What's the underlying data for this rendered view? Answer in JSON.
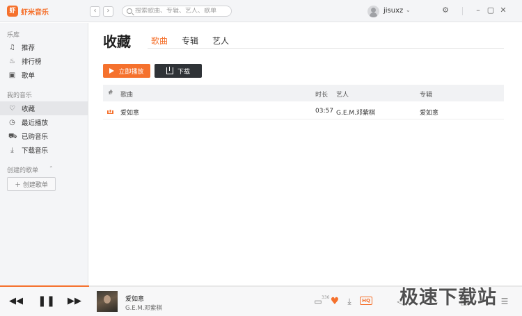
{
  "app": {
    "logo_glyph": "虾",
    "name": "虾米音乐",
    "accent": "#f5712d"
  },
  "header": {
    "search_placeholder": "搜索歌曲、专辑、艺人、歌单",
    "username": "jisuxz",
    "back_glyph": "‹",
    "forward_glyph": "›",
    "caret": "⌄"
  },
  "sidebar": {
    "section_library": "乐库",
    "library_items": [
      {
        "label": "推荐",
        "icon": "music-note-icon"
      },
      {
        "label": "排行榜",
        "icon": "flame-icon"
      },
      {
        "label": "歌单",
        "icon": "playlist-icon"
      }
    ],
    "section_my_music": "我的音乐",
    "my_items": [
      {
        "label": "收藏",
        "icon": "heart-icon"
      },
      {
        "label": "最近播放",
        "icon": "clock-icon"
      },
      {
        "label": "已购音乐",
        "icon": "cart-icon"
      },
      {
        "label": "下载音乐",
        "icon": "download-icon"
      }
    ],
    "section_created": "创建的歌单",
    "create_button": "＋ 创建歌单"
  },
  "main": {
    "title": "收藏",
    "tabs": [
      "歌曲",
      "专辑",
      "艺人"
    ],
    "play_all": "立即播放",
    "download": "下载",
    "columns": {
      "index": "#",
      "song": "歌曲",
      "duration": "时长",
      "artist": "艺人",
      "album": "专辑"
    },
    "rows": [
      {
        "song": "爱如意",
        "duration": "03:57",
        "artist": "G.E.M.邓紫棋",
        "album": "爱如意"
      }
    ]
  },
  "player": {
    "title": "爱如意",
    "artist": "G.E.M.邓紫棋",
    "comment_count": "336",
    "hq_label": "HQ",
    "progress": 0.17
  },
  "watermark": "极速下载站"
}
